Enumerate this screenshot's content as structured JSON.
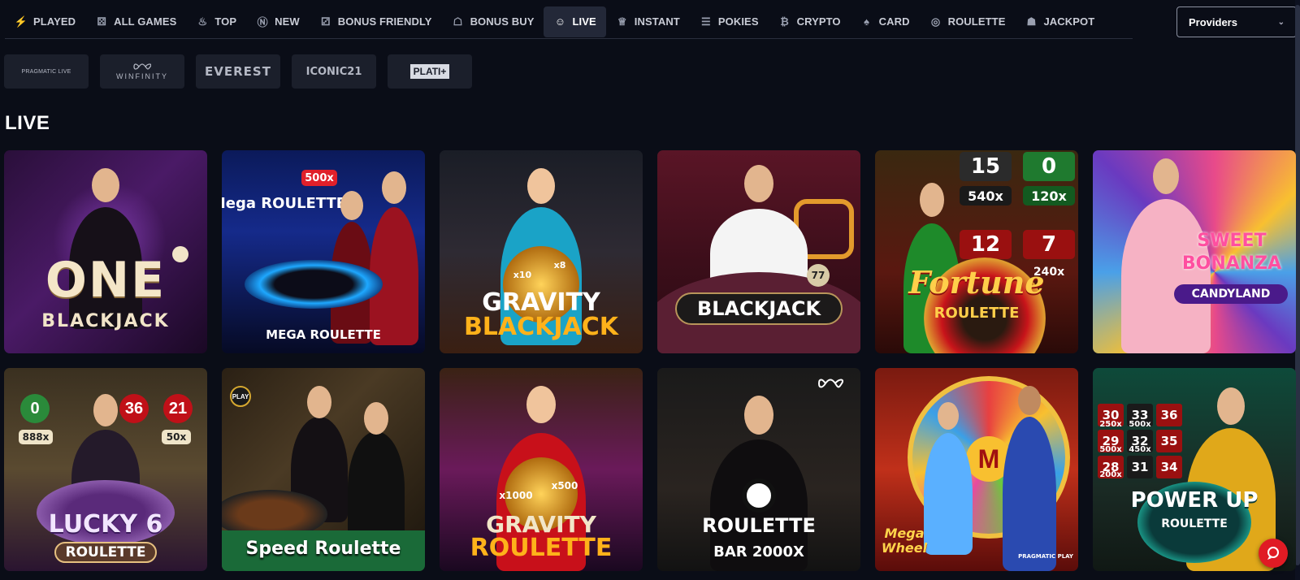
{
  "nav": {
    "items": [
      {
        "label": "PLAYED",
        "icon": "lightning-icon"
      },
      {
        "label": "ALL GAMES",
        "icon": "dice-icon"
      },
      {
        "label": "TOP",
        "icon": "flame-icon"
      },
      {
        "label": "NEW",
        "icon": "new-badge-icon"
      },
      {
        "label": "BONUS FRIENDLY",
        "icon": "bonus-dice-icon"
      },
      {
        "label": "BONUS BUY",
        "icon": "gift-icon"
      },
      {
        "label": "LIVE",
        "icon": "dealer-icon",
        "active": true
      },
      {
        "label": "INSTANT",
        "icon": "crown-icon"
      },
      {
        "label": "POKIES",
        "icon": "slot-777-icon"
      },
      {
        "label": "CRYPTO",
        "icon": "bitcoin-icon"
      },
      {
        "label": "CARD",
        "icon": "cards-icon"
      },
      {
        "label": "ROULETTE",
        "icon": "roulette-icon"
      },
      {
        "label": "JACKPOT",
        "icon": "jackpot-icon"
      }
    ],
    "providers_label": "Providers"
  },
  "providers": [
    {
      "label": "PRAGMATIC LIVE"
    },
    {
      "label": "WINFINITY"
    },
    {
      "label": "EVEREST"
    },
    {
      "label": "ICONIC21"
    },
    {
      "label": "PLATI+"
    }
  ],
  "section_title": "LIVE",
  "games": [
    {
      "title": "ONE",
      "subtitle": "BLACKJACK"
    },
    {
      "title": "Mega ROULETTE",
      "subtitle": "MEGA ROULETTE",
      "badge": "500x"
    },
    {
      "title": "GRAVITY",
      "subtitle": "BLACKJACK",
      "mults": [
        "x10",
        "x8"
      ]
    },
    {
      "title": "BLACKJACK",
      "badge": "77"
    },
    {
      "title": "Fortune",
      "subtitle": "ROULETTE",
      "nums": [
        "15",
        "0",
        "12",
        "7"
      ],
      "mults": [
        "540x",
        "120x",
        "240x"
      ]
    },
    {
      "title": "SWEET BONANZA",
      "subtitle": "CANDYLAND"
    },
    {
      "title": "LUCKY 6",
      "subtitle": "ROULETTE",
      "nums": [
        "0",
        "36",
        "21"
      ],
      "mults": [
        "888x",
        "50x"
      ]
    },
    {
      "title": "Speed Roulette",
      "badge": "PLAY"
    },
    {
      "title": "GRAVITY",
      "subtitle": "ROULETTE",
      "mults": [
        "x1000",
        "x500"
      ]
    },
    {
      "title": "ROULETTE",
      "subtitle": "BAR 2000X"
    },
    {
      "title": "Mega Wheel",
      "badge": "M",
      "brand": "PRAGMATIC PLAY"
    },
    {
      "title": "POWER UP",
      "subtitle": "ROULETTE",
      "nums": [
        "30",
        "33",
        "36",
        "29",
        "32",
        "35",
        "28",
        "31",
        "34"
      ],
      "mults": [
        "250x",
        "500x",
        "500x",
        "450x",
        "200x"
      ]
    }
  ]
}
